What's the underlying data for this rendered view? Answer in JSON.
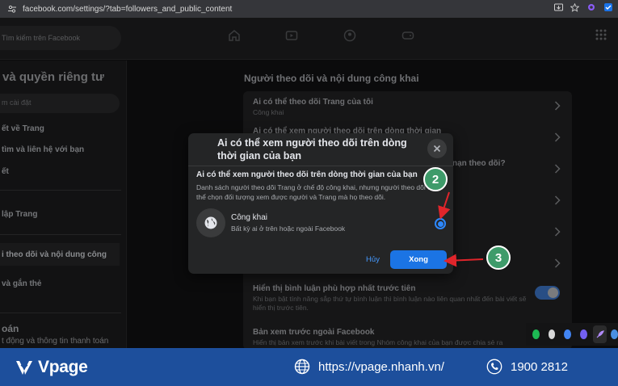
{
  "browser": {
    "url": "facebook.com/settings/?tab=followers_and_public_content"
  },
  "fb": {
    "search_placeholder": "Tìm kiếm trên Facebook"
  },
  "sidebar": {
    "title": "và quyền riêng tư",
    "search_placeholder": "m cài đặt",
    "items": [
      {
        "label": "ết về Trang"
      },
      {
        "label": "tìm và liên hệ với bạn"
      },
      {
        "label": "ết"
      },
      {
        "label": "lập Trang"
      },
      {
        "label": "i theo dõi và nội dung công"
      },
      {
        "label": "và gắn thẻ"
      },
      {
        "label": "oán"
      },
      {
        "label": "t động và thông tin thanh toán"
      }
    ]
  },
  "main": {
    "title": "Người theo dõi và nội dung công khai",
    "rows": [
      {
        "title": "Ai có thể theo dõi Trang của tôi",
        "subtitle": "Công khai"
      },
      {
        "title": "Ai có thể xem người theo dõi trên dòng thời gian",
        "subtitle": ""
      },
      {
        "title": "nạn theo dõi?",
        "subtitle": ""
      },
      {
        "title": "Hiển thị bình luận phù hợp nhất trước tiên",
        "subtitle": "Khi bạn bật tính năng sắp thứ tự bình luận thì bình luận nào liên quan nhất đến bài viết sẽ hiển thị trước tiên."
      },
      {
        "title": "Bản xem trước ngoài Facebook",
        "subtitle": "Hiển thị bản xem trước khi bài viết trong Nhóm công khai của bạn được chia sẻ ra"
      }
    ],
    "toggle_on": true
  },
  "modal": {
    "title": "Ai có thể xem người theo dõi trên dòng thời gian của bạn",
    "question": "Ai có thể xem người theo dõi trên dòng thời gian của bạn",
    "description": "Danh sách người theo dõi Trang ở chế độ công khai, nhưng người theo dõi có thể chọn đối tượng xem được người và Trang mà họ theo dõi.",
    "option_label": "Công khai",
    "option_sub": "Bất kỳ ai ở trên hoặc ngoài Facebook",
    "option_selected": true,
    "cancel_label": "Hủy",
    "done_label": "Xong"
  },
  "annotations": {
    "step_2": "2",
    "step_3": "3",
    "arrow_color": "#e0252b",
    "badge_color": "#3e9b6a"
  },
  "banner": {
    "brand": "Vpage",
    "website": "https://vpage.nhanh.vn/",
    "phone": "1900 2812",
    "bg_color": "#1d4f9c"
  }
}
